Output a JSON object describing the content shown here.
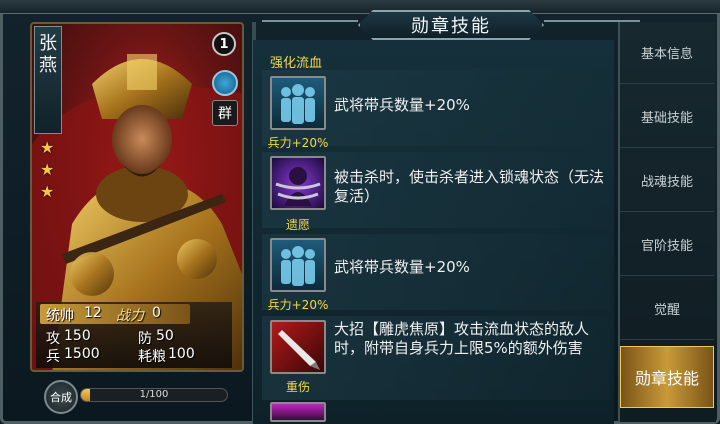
{
  "title": "勋章技能",
  "hero": {
    "name_chars": [
      "张",
      "燕"
    ],
    "stars": 3,
    "level": "1",
    "faction": "群",
    "stats": {
      "command_label": "统帅",
      "command_value": "12",
      "power_label": "战力",
      "power_value": "0",
      "attack_label": "攻",
      "attack_value": "150",
      "defense_label": "防",
      "defense_value": "50",
      "troops_label": "兵",
      "troops_value": "1500",
      "food_label": "耗粮",
      "food_value": "100"
    }
  },
  "craft": {
    "button_label": "合成",
    "progress_text": "1/100",
    "progress_fraction": 0.01
  },
  "skill_section_label": "强化流血",
  "skills": [
    {
      "caption": "兵力+20%",
      "text": "武将带兵数量+20%",
      "icon": "soldiers-icon"
    },
    {
      "caption": "遗愿",
      "text": "被击杀时，使击杀者进入锁魂状态（无法复活）",
      "icon": "chained-soul-icon"
    },
    {
      "caption": "兵力+20%",
      "text": "武将带兵数量+20%",
      "icon": "soldiers-icon"
    },
    {
      "caption": "重伤",
      "text": "大招【雕虎焦原】攻击流血状态的敌人时，附带自身兵力上限5%的额外伤害",
      "icon": "blade-icon"
    }
  ],
  "tabs": [
    "基本信息",
    "基础技能",
    "战魂技能",
    "官阶技能",
    "觉醒",
    "勋章技能"
  ],
  "active_tab": "勋章技能"
}
